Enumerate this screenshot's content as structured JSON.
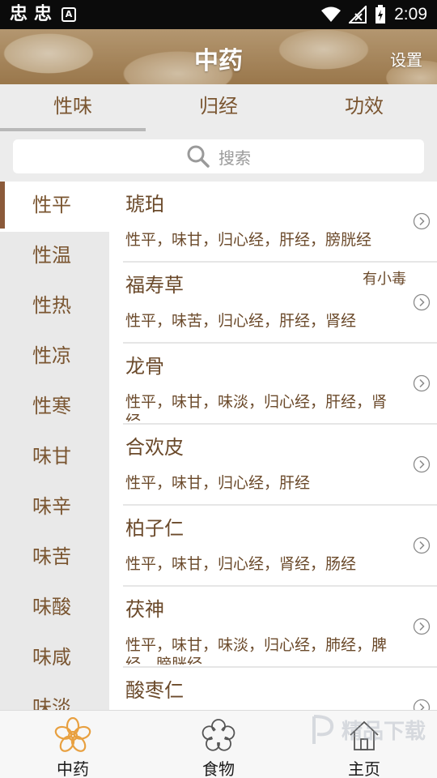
{
  "status_bar": {
    "time": "2:09"
  },
  "header": {
    "title": "中药",
    "settings_label": "设置"
  },
  "tabs": [
    {
      "label": "性味",
      "active": true
    },
    {
      "label": "归经",
      "active": false
    },
    {
      "label": "功效",
      "active": false
    }
  ],
  "search": {
    "placeholder": "搜索"
  },
  "categories": [
    {
      "label": "性平",
      "active": true
    },
    {
      "label": "性温"
    },
    {
      "label": "性热"
    },
    {
      "label": "性凉"
    },
    {
      "label": "性寒"
    },
    {
      "label": "味甘"
    },
    {
      "label": "味辛"
    },
    {
      "label": "味苦"
    },
    {
      "label": "味酸"
    },
    {
      "label": "味咸"
    },
    {
      "label": "味淡"
    }
  ],
  "items": [
    {
      "name": "琥珀",
      "note": "",
      "props": "性平，味甘，归心经，肝经，膀胱经"
    },
    {
      "name": "福寿草",
      "note": "有小毒",
      "props": "性平，味苦，归心经，肝经，肾经"
    },
    {
      "name": "龙骨",
      "note": "",
      "props": "性平，味甘，味淡，归心经，肝经，肾经"
    },
    {
      "name": "合欢皮",
      "note": "",
      "props": "性平，味甘，归心经，肝经"
    },
    {
      "name": "柏子仁",
      "note": "",
      "props": "性平，味甘，归心经，肾经，肠经"
    },
    {
      "name": "茯神",
      "note": "",
      "props": "性平，味甘，味淡，归心经，肺经，脾经，膀胱经"
    },
    {
      "name": "酸枣仁",
      "note": "",
      "props": ""
    }
  ],
  "bottom_nav": [
    {
      "label": "中药",
      "icon": "flower-icon"
    },
    {
      "label": "食物",
      "icon": "flower-outline-icon"
    },
    {
      "label": "主页",
      "icon": "home-icon"
    }
  ],
  "watermark": {
    "text": "精品下载"
  },
  "colors": {
    "accent_brown": "#8b5a3a",
    "text_brown": "#6b4a2b",
    "nav_orange": "#e8a040"
  }
}
